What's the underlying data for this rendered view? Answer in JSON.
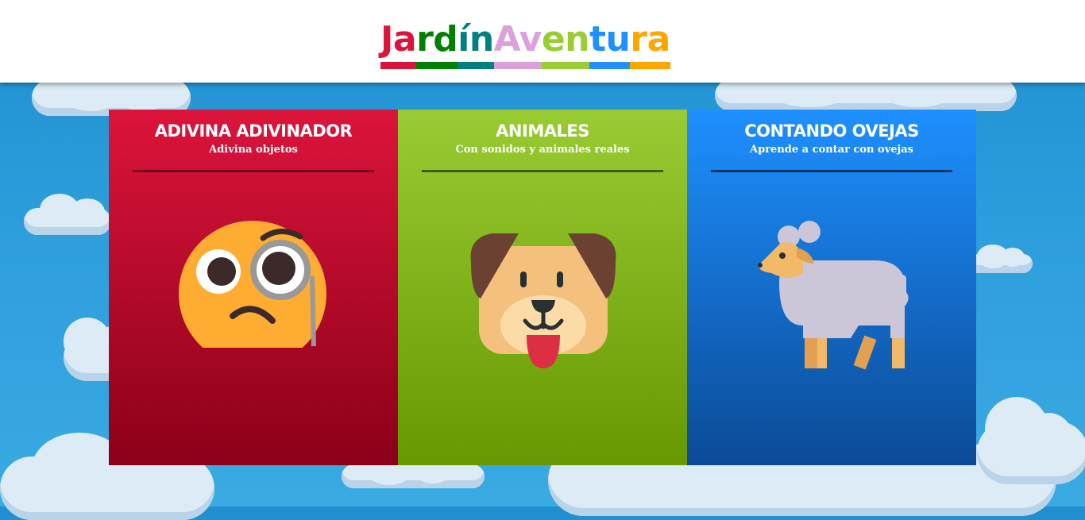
{
  "header": {
    "logo_segments": [
      {
        "text": "Ja",
        "color": "#dc143c"
      },
      {
        "text": "rd",
        "color": "#008000"
      },
      {
        "text": "ín",
        "color": "#008080"
      },
      {
        "text": "Av",
        "color": "#dda0dd"
      },
      {
        "text": "en",
        "color": "#9acd32"
      },
      {
        "text": "tu",
        "color": "#1e90ff"
      },
      {
        "text": "ra",
        "color": "#ffa500"
      }
    ]
  },
  "cards": [
    {
      "title": "ADIVINA ADIVINADOR",
      "subtitle": "Adivina objetos",
      "color": "#dc143c",
      "icon": "monocle-face-icon"
    },
    {
      "title": "ANIMALES",
      "subtitle": "Con sonidos y animales reales",
      "color": "#9acd32",
      "icon": "dog-face-icon"
    },
    {
      "title": "CONTANDO OVEJAS",
      "subtitle": "Aprende a contar con ovejas",
      "color": "#1e90ff",
      "icon": "sheep-icon"
    }
  ]
}
